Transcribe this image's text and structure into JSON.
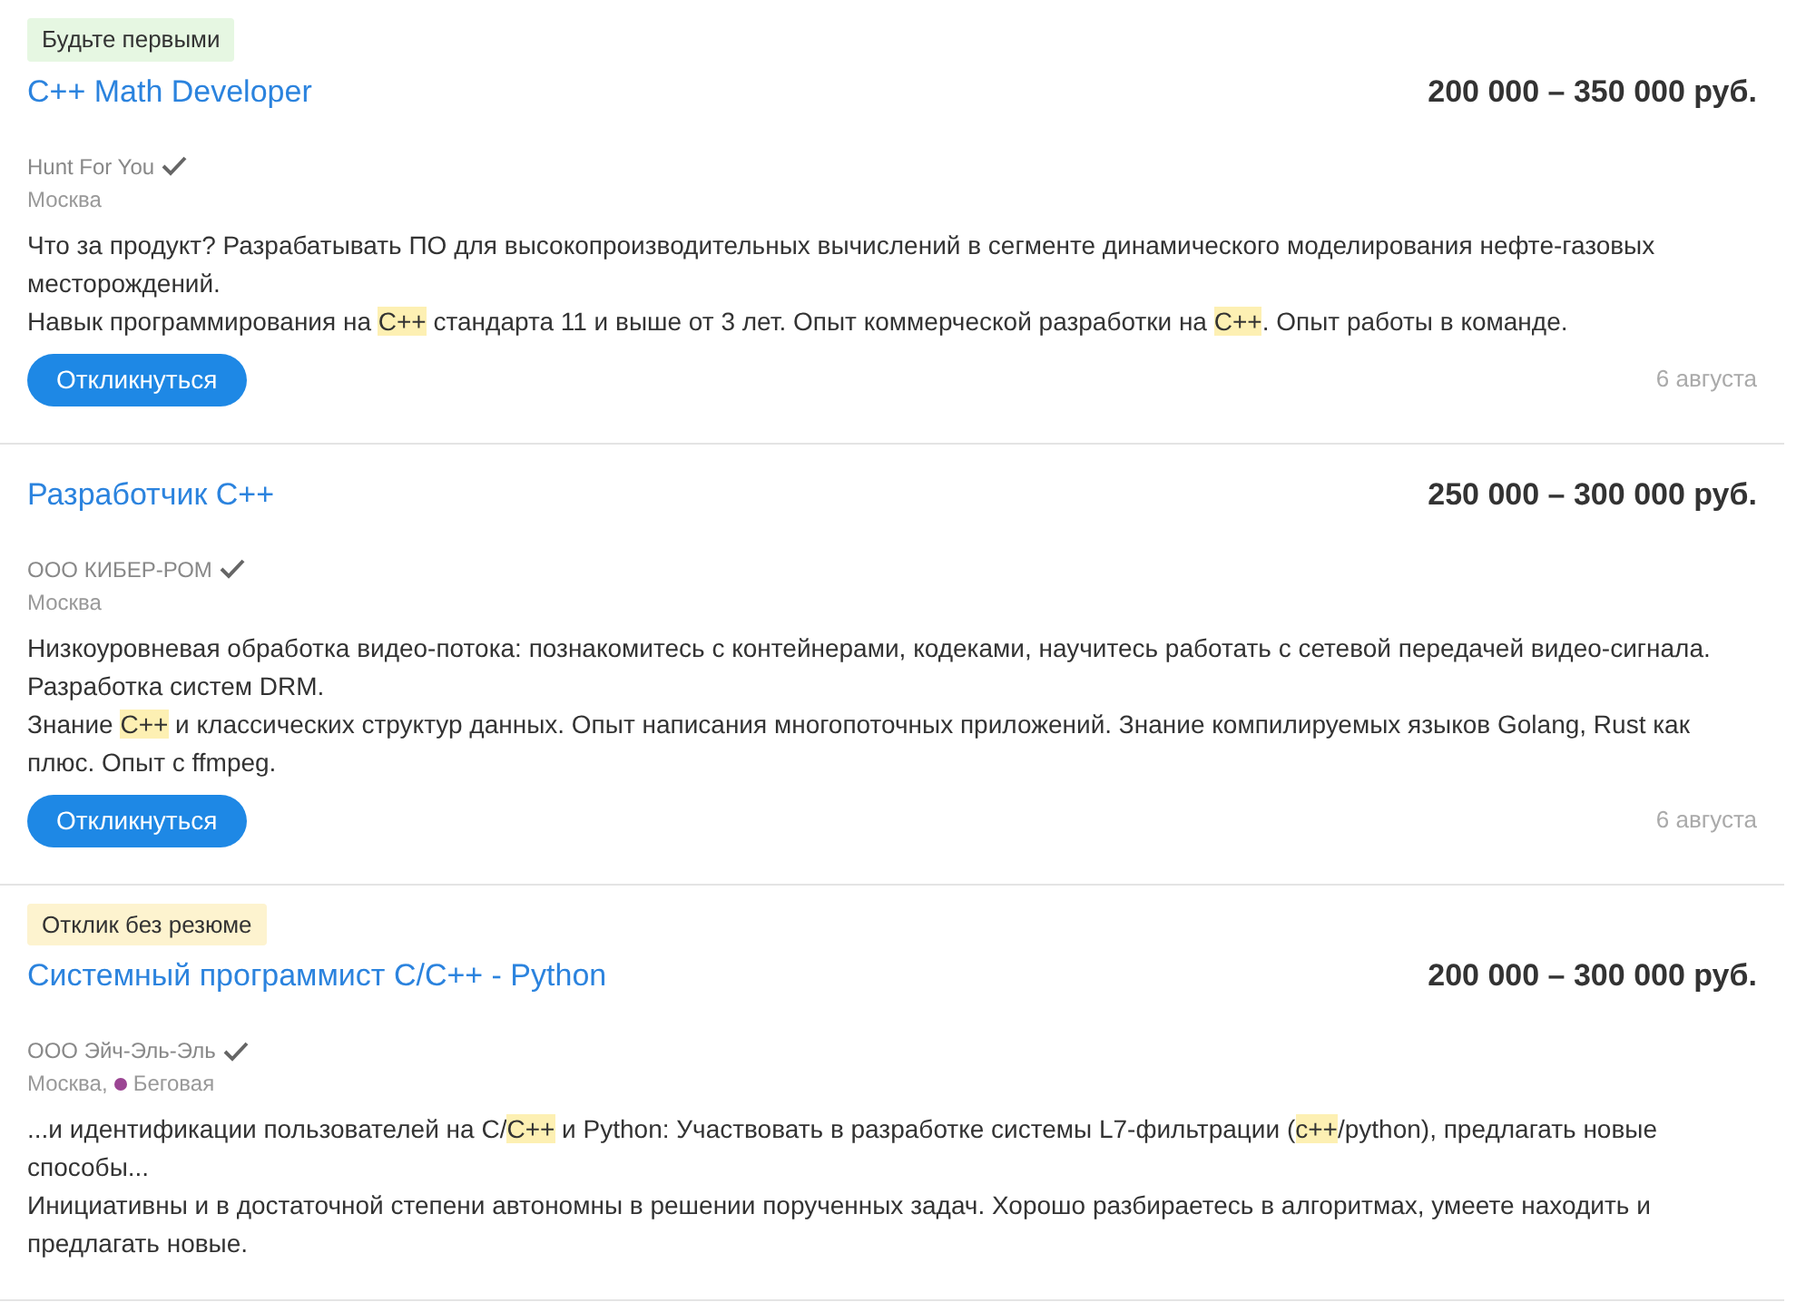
{
  "vacancies": [
    {
      "badge": {
        "kind": "first",
        "text": "Будьте первыми"
      },
      "title": "C++ Math Developer",
      "salary": "200 000 – 350 000 руб.",
      "company": "Hunt For You",
      "verified": true,
      "city": "Москва",
      "paragraphs": [
        [
          {
            "text": "Что за продукт? Разрабатывать ПО для высокопроизводительных вычислений в сегменте динамического моделирования нефте-газовых месторождений.",
            "highlight": false
          }
        ],
        [
          {
            "text": "Навык программирования на ",
            "highlight": false
          },
          {
            "text": "C++",
            "highlight": true
          },
          {
            "text": " стандарта 11 и выше от 3 лет. Опыт коммерческой разработки на ",
            "highlight": false
          },
          {
            "text": "C++",
            "highlight": true
          },
          {
            "text": ". Опыт работы в команде.",
            "highlight": false
          }
        ]
      ],
      "button": "Откликнуться",
      "date": "6 августа"
    },
    {
      "title": "Разработчик С++",
      "salary": "250 000 – 300 000 руб.",
      "company": "ООО КИБЕР-РОМ",
      "verified": true,
      "city": "Москва",
      "paragraphs": [
        [
          {
            "text": "Низкоуровневая обработка видео-потока: познакомитесь с контейнерами, кодеками, научитесь работать с сетевой передачей видео-сигнала. Разработка систем DRM.",
            "highlight": false
          }
        ],
        [
          {
            "text": "Знание ",
            "highlight": false
          },
          {
            "text": "C++",
            "highlight": true
          },
          {
            "text": " и классических структур данных. Опыт написания многопоточных приложений. Знание компилируемых языков Golang, Rust как плюс. Опыт с ffmpeg.",
            "highlight": false
          }
        ]
      ],
      "button": "Откликнуться",
      "date": "6 августа"
    },
    {
      "badge": {
        "kind": "no_resume",
        "text": "Отклик без резюме"
      },
      "title": "Системный программист C/C++ - Python",
      "salary": "200 000 – 300 000 руб.",
      "company": "ООО Эйч-Эль-Эль",
      "verified": true,
      "city": "Москва,",
      "metro": {
        "name": "Беговая",
        "color": "#9b4593"
      },
      "paragraphs": [
        [
          {
            "text": "...и идентификации пользователей на C/",
            "highlight": false
          },
          {
            "text": "C++",
            "highlight": true
          },
          {
            "text": " и Python: Участвовать в разработке системы L7-фильтрации (",
            "highlight": false
          },
          {
            "text": "c++",
            "highlight": true
          },
          {
            "text": "/python), предлагать новые способы...",
            "highlight": false
          }
        ],
        [
          {
            "text": "Инициативны и в достаточной степени автономны в решении порученных задач. Хорошо разбираетесь в алгоритмах, умеете находить и предлагать новые.",
            "highlight": false
          }
        ]
      ]
    }
  ]
}
